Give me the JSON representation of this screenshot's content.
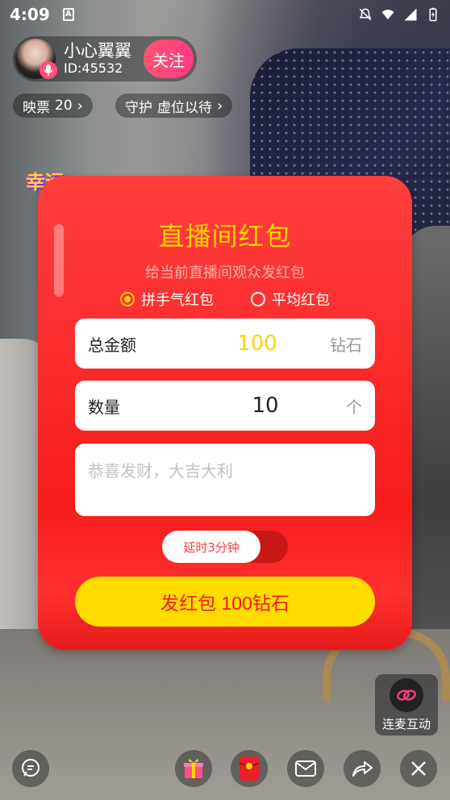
{
  "status_bar": {
    "time": "4:09",
    "a_label": "A"
  },
  "host": {
    "name": "小心翼翼",
    "id": "ID:45532",
    "follow_label": "关注"
  },
  "pills": {
    "ticket_label": "映票",
    "ticket_count": "20",
    "guard_label": "守护",
    "guard_value": "虚位以待"
  },
  "lucky_badge": "幸运",
  "red_packet": {
    "title": "直播间红包",
    "subtitle": "给当前直播间观众发红包",
    "options": [
      {
        "label": "拼手气红包",
        "selected": true
      },
      {
        "label": "平均红包",
        "selected": false
      }
    ],
    "amount": {
      "label": "总金额",
      "value": "100",
      "unit": "钻石"
    },
    "count": {
      "label": "数量",
      "value": "10",
      "unit": "个"
    },
    "message_placeholder": "恭喜发财，大吉大利",
    "delay_label": "延时3分钟",
    "send_label": "发红包 100钻石"
  },
  "lianmai_label": "连麦互动",
  "colors": {
    "accent_yellow": "#ffd400",
    "panel_red": "#f61c1c",
    "follow_pink": "#ff3b82"
  }
}
